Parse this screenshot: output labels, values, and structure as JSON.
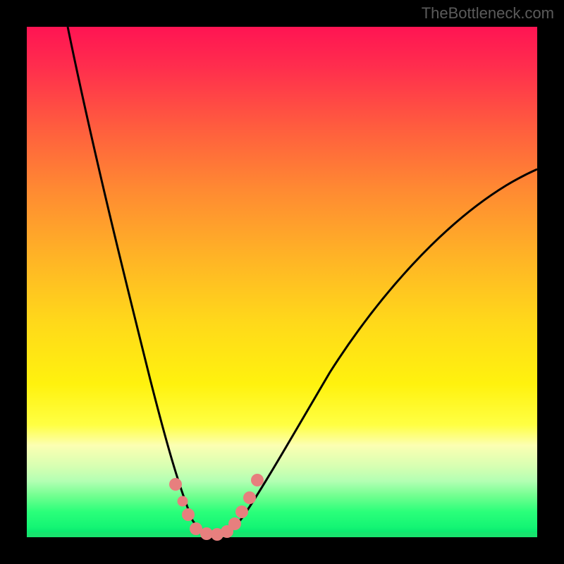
{
  "watermark": "TheBottleneck.com",
  "chart_data": {
    "type": "line",
    "title": "",
    "xlabel": "",
    "ylabel": "",
    "xlim": [
      0,
      100
    ],
    "ylim": [
      0,
      100
    ],
    "grid": false,
    "series": [
      {
        "name": "left-curve",
        "x": [
          8,
          12,
          16,
          20,
          24,
          27,
          30,
          33,
          36
        ],
        "values": [
          100,
          78,
          56,
          38,
          23,
          12,
          5,
          1,
          0
        ]
      },
      {
        "name": "right-curve",
        "x": [
          36,
          40,
          45,
          52,
          60,
          70,
          82,
          94,
          100
        ],
        "values": [
          0,
          2,
          8,
          18,
          30,
          44,
          58,
          68,
          72
        ]
      }
    ],
    "markers": {
      "name": "highlighted-points",
      "color": "#e77f7e",
      "points": [
        {
          "x": 29.0,
          "y": 10.0
        },
        {
          "x": 30.5,
          "y": 6.5
        },
        {
          "x": 31.5,
          "y": 4.0
        },
        {
          "x": 33.0,
          "y": 1.0
        },
        {
          "x": 35.0,
          "y": 0.5
        },
        {
          "x": 37.0,
          "y": 0.5
        },
        {
          "x": 39.0,
          "y": 1.0
        },
        {
          "x": 40.5,
          "y": 2.5
        },
        {
          "x": 42.0,
          "y": 5.0
        },
        {
          "x": 43.5,
          "y": 7.5
        },
        {
          "x": 45.0,
          "y": 11.0
        }
      ]
    },
    "background_gradient": {
      "top": "#ff1453",
      "middle": "#fff20e",
      "bottom": "#00e06c"
    }
  }
}
